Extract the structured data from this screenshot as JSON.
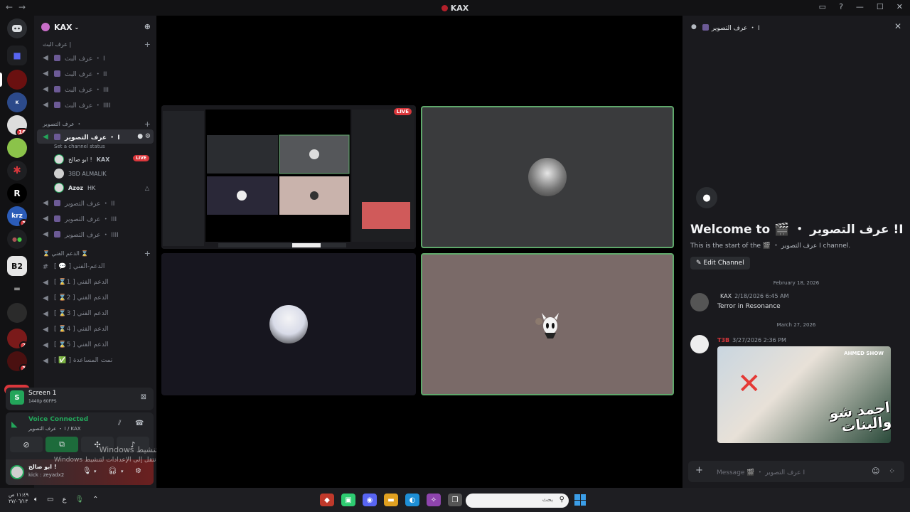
{
  "titlebar": {
    "title": "KAX"
  },
  "server": {
    "name": "KAX"
  },
  "categories": {
    "broadcast": "عرف البث |",
    "filming": "عرف التصوير ・",
    "support": "⌛ الدعم الفني ⌛"
  },
  "broadcast_channels": [
    "عرف البث ・ I",
    "عرف البث ・ II",
    "عرف البث ・ III",
    "عرف البث ・ IIII"
  ],
  "active_channel": {
    "label": "عرف التصوير ・ I",
    "status_placeholder": "Set a channel status"
  },
  "voice_users": [
    {
      "name": "ابو صالح !",
      "tag": "KAX",
      "live": "LIVE"
    },
    {
      "name": "3BD ALMALIK",
      "tag": "",
      "live": ""
    },
    {
      "name": "Azoz",
      "tag": "HK",
      "live": ""
    }
  ],
  "filming_channels": [
    "عرف التصوير ・ II",
    "عرف التصوير ・ III",
    "عرف التصوير ・ IIII"
  ],
  "support_channels": [
    "[ 💬 ] الدعم-الفني",
    "[ ⌛1 ] الدعم الفني",
    "[ ⌛2 ] الدعم الفني",
    "[ ⌛3 ] الدعم الفني",
    "[ ⌛4 ] الدعم الفني",
    "[ ⌛5 ] الدعم الفني",
    "[ ✅ ] تمت المساعدة"
  ],
  "guild_badges": {
    "b1": "16",
    "b2": "3",
    "b3": "2",
    "b4": "3",
    "new": "NEW"
  },
  "guild_labels": {
    "b2": "B2",
    "krz": "krz",
    "r": "R"
  },
  "screen_panel": {
    "title": "Screen 1",
    "quality": "1440p 60FPS"
  },
  "voice_panel": {
    "status": "Voice Connected",
    "location": "عرف التصوير ・ I / KAX"
  },
  "user_panel": {
    "name": "ابو صالح !",
    "subtitle": "kick : zeyadx2"
  },
  "watermark": {
    "line1": "تنشيط Windows",
    "line2": "انتقل إلى الإعدادات لتنشيط Windows"
  },
  "stage": {
    "live_label": "LIVE"
  },
  "thread": {
    "header": "عرف التصوير ・ I",
    "welcome_title": "Welcome to 🎬 ・ عرف التصوير !I",
    "welcome_sub": "This is the start of the 🎬 ・ عرف التصوير I channel.",
    "edit_button": "Edit Channel",
    "divider1": "February 18, 2026",
    "divider2": "March 27, 2026",
    "msg1": {
      "name": "",
      "tag": "KAX",
      "time": "2/18/2026 6:45 AM",
      "text": "Terror in Resonance"
    },
    "msg2": {
      "name": "T3B",
      "time": "3/27/2026 2:36 PM",
      "embed_label": "احمد شو والبنات",
      "embed_brand": "AHMED SHOW"
    },
    "composer_placeholder": "Message 🎬 ・ عرف التصوير I"
  },
  "taskbar": {
    "time": "١١:٤٩ ص",
    "date": "٢٧/٠٦/١٣",
    "search_placeholder": "بحث",
    "lang": "ع"
  },
  "colors": {
    "accent_green": "#23a55a",
    "live_red": "#da373c",
    "blurple": "#5865f2"
  }
}
